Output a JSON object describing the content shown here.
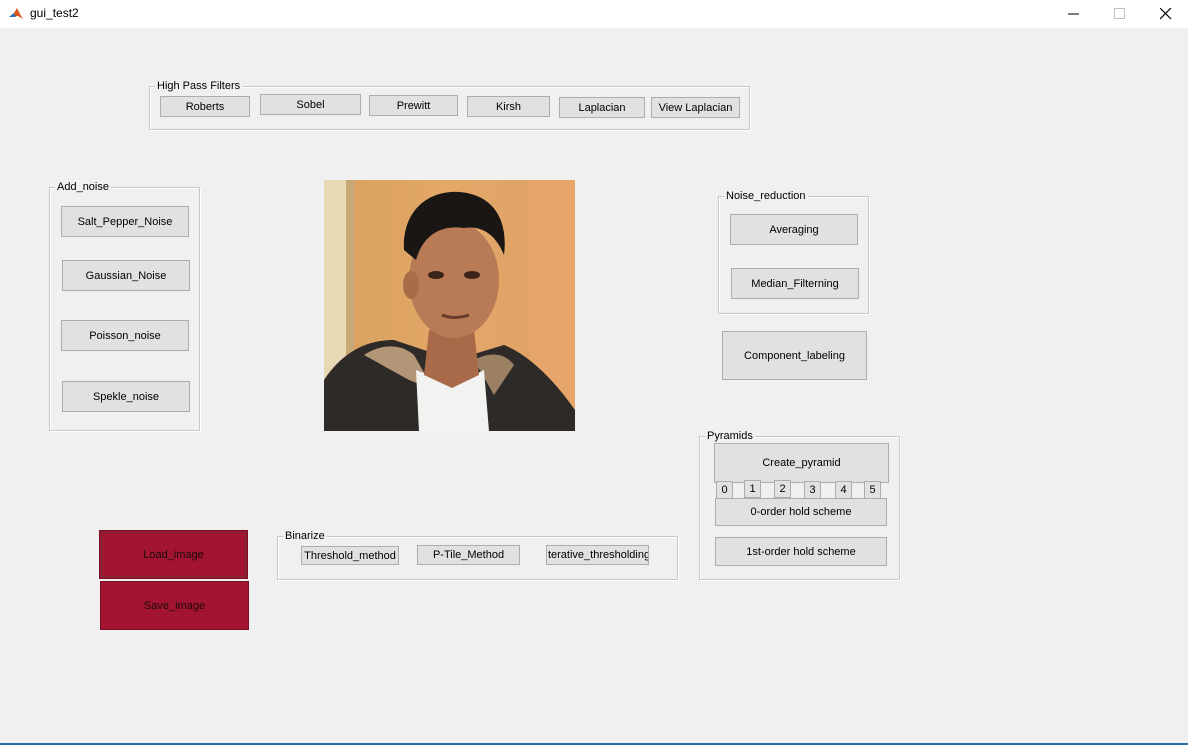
{
  "window": {
    "title": "gui_test2",
    "app_icon": "matlab-icon"
  },
  "high_pass": {
    "title": "High Pass Filters",
    "buttons": [
      "Roberts",
      "Sobel",
      "Prewitt",
      "Kirsh",
      "Laplacian",
      "View Laplacian"
    ]
  },
  "add_noise": {
    "title": "Add_noise",
    "buttons": [
      "Salt_Pepper_Noise",
      "Gaussian_Noise",
      "Poisson_noise",
      "Spekle_noise"
    ]
  },
  "noise_reduction": {
    "title": "Noise_reduction",
    "buttons": [
      "Averaging",
      "Median_Filterning"
    ]
  },
  "component_labeling": "Component_labeling",
  "pyramids": {
    "title": "Pyramids",
    "create": "Create_pyramid",
    "levels": [
      "0",
      "1",
      "2",
      "3",
      "4",
      "5"
    ],
    "zero_order": "0-order hold scheme",
    "first_order": "1st-order hold scheme"
  },
  "binarize": {
    "title": "Binarize",
    "buttons": [
      "Threshold_method",
      "P-Tile_Method",
      "Iterative_thresholding"
    ]
  },
  "file": {
    "load": "Load_image",
    "save": "Save_image",
    "button_color": "#a2142f"
  }
}
